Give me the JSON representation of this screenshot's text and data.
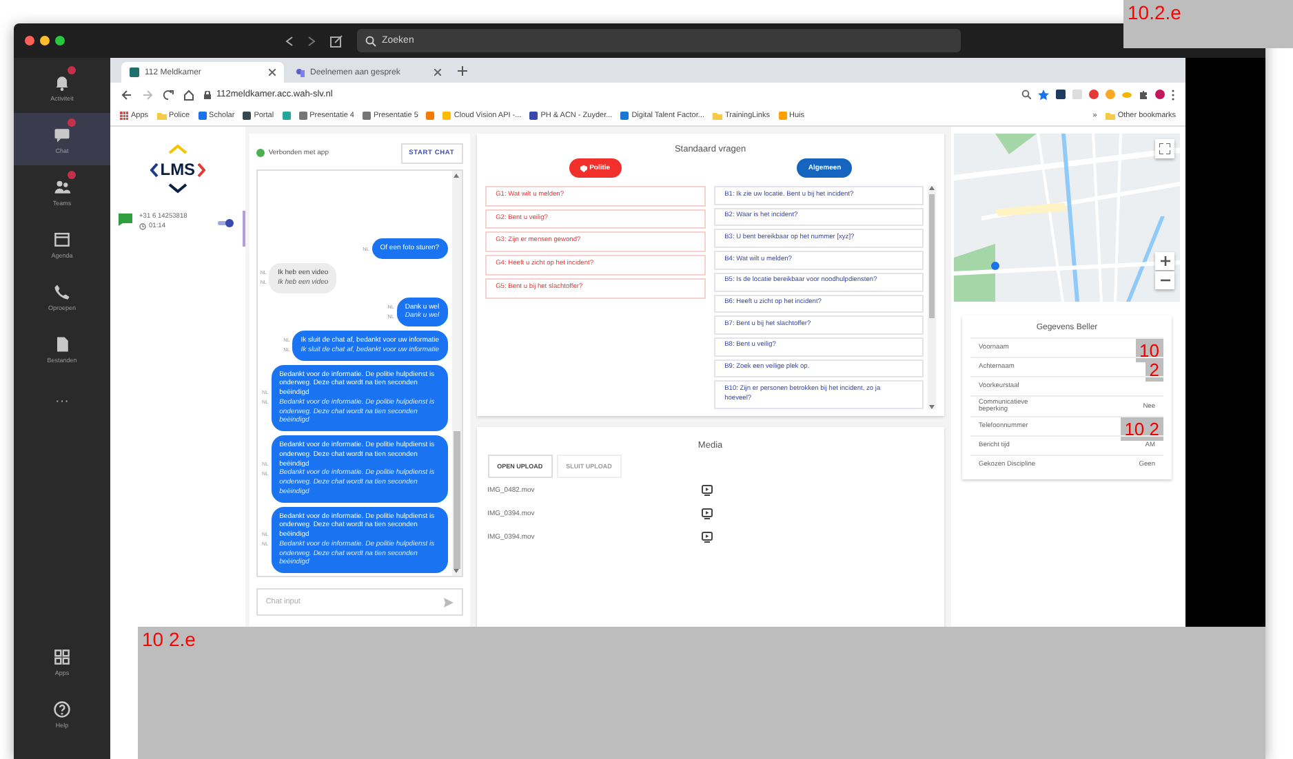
{
  "redactions": {
    "top": "10.2.e",
    "bottom": "10 2.e"
  },
  "teams": {
    "search_placeholder": "Zoeken",
    "rail": [
      {
        "kind": "bell",
        "label": "Activiteit",
        "badge": true,
        "selected": false
      },
      {
        "kind": "chat",
        "label": "Chat",
        "badge": true,
        "selected": true
      },
      {
        "kind": "people",
        "label": "Teams",
        "badge": true,
        "selected": false
      },
      {
        "kind": "calendar",
        "label": "Agenda",
        "badge": false,
        "selected": false
      },
      {
        "kind": "phone",
        "label": "Oproepen",
        "badge": false,
        "selected": false
      },
      {
        "kind": "file",
        "label": "Bestanden",
        "badge": false,
        "selected": false
      },
      {
        "kind": "more",
        "label": "···",
        "badge": false,
        "selected": false
      }
    ],
    "rail_bottom": [
      {
        "kind": "apps",
        "label": "Apps"
      },
      {
        "kind": "help",
        "label": "Help"
      }
    ]
  },
  "browser": {
    "tabs": [
      {
        "title": "112 Meldkamer",
        "kind": "site",
        "selected": true
      },
      {
        "title": "Deelnemen aan gesprek",
        "kind": "teams",
        "selected": false
      }
    ],
    "url": "112meldkamer.acc.wah-slv.nl",
    "bookmarks": [
      {
        "kind": "apps",
        "label": "Apps"
      },
      {
        "kind": "folder",
        "label": "Police"
      },
      {
        "kind": "site",
        "label": "Scholar",
        "color": "#1a73e8"
      },
      {
        "kind": "site",
        "label": "Portal",
        "color": "#37474f"
      },
      {
        "kind": "site",
        "color": "#26a69a"
      },
      {
        "kind": "site",
        "label": "Presentatie 4",
        "color": "#757575"
      },
      {
        "kind": "site",
        "label": "Presentatie 5",
        "color": "#757575"
      },
      {
        "kind": "site",
        "color": "#f57c00"
      },
      {
        "kind": "site",
        "label": "Cloud Vision API -...",
        "color": "#fbbc04"
      },
      {
        "kind": "site",
        "label": "PH & ACN - Zuyder...",
        "color": "#3949ab"
      },
      {
        "kind": "site",
        "label": "Digital Talent Factor...",
        "color": "#1976d2"
      },
      {
        "kind": "folder",
        "label": "TrainingLinks"
      },
      {
        "kind": "site",
        "label": "Huis",
        "color": "#ffa000"
      }
    ],
    "more_bookmarks": "»",
    "other_bookmarks": "Other bookmarks"
  },
  "lms": {
    "logo": "LMS",
    "calls": [
      {
        "phone": "+31 6 14253818",
        "time": "01:14",
        "selected": true
      }
    ]
  },
  "chat": {
    "status": "Verbonden met app",
    "connected": true,
    "start_button": "START CHAT",
    "input_placeholder": "Chat input",
    "messages": [
      {
        "kind": "sent",
        "text": "Of een foto sturen?",
        "tags": [
          "NL"
        ]
      },
      {
        "kind": "received",
        "text": "Ik heb een video",
        "translation": "Ik heb een video",
        "tags": [
          "NL",
          "NL"
        ]
      },
      {
        "kind": "sent",
        "text": "Dank u wel",
        "translation": "Dank u wel",
        "tags": [
          "NL",
          "NL"
        ]
      },
      {
        "kind": "sent",
        "text": "Ik sluit de chat af, bedankt voor uw informatie",
        "translation": "Ik sluit de chat af, bedankt voor uw informatie",
        "tags": [
          "NL",
          "NL"
        ]
      },
      {
        "kind": "sent",
        "text": "Bedankt voor de informatie. De politie hulpdienst is onderweg. Deze chat wordt na tien seconden beëindigd",
        "translation": "Bedankt voor de informatie. De politie hulpdienst is onderweg. Deze chat wordt na tien seconden beëindigd",
        "tags": [
          "NL",
          "NL"
        ]
      },
      {
        "kind": "sent",
        "text": "Bedankt voor de informatie. De politie hulpdienst is onderweg. Deze chat wordt na tien seconden beëindigd",
        "translation": "Bedankt voor de informatie. De politie hulpdienst is onderweg. Deze chat wordt na tien seconden beëindigd",
        "tags": [
          "NL",
          "NL"
        ]
      },
      {
        "kind": "sent",
        "text": "Bedankt voor de informatie. De politie hulpdienst is onderweg. Deze chat wordt na tien seconden beëindigd",
        "translation": "Bedankt voor de informatie. De politie hulpdienst is onderweg. Deze chat wordt na tien seconden beëindigd",
        "tags": [
          "NL",
          "NL"
        ]
      }
    ]
  },
  "questions": {
    "title": "Standaard vragen",
    "groups": [
      {
        "kind": "police",
        "button": "Politie",
        "items": [
          "G1: Wat wilt u melden?",
          "G2: Bent u veilig?",
          "G3: Zijn er mensen gewond?",
          "G4: Heeft u zicht op het incident?",
          "G5: Bent u bij het slachtoffer?"
        ]
      },
      {
        "kind": "general",
        "button": "Algemeen",
        "items": [
          "B1: Ik zie uw locatie. Bent u bij het incident?",
          "B2: Waar is het incident?",
          "B3: U bent bereikbaar op het nummer [xyz]?",
          "B4: Wat wilt u melden?",
          "B5: Is de locatie bereikbaar voor noodhulpdiensten?",
          "B6: Heeft u zicht op het incident?",
          "B7: Bent u bij het slachtoffer?",
          "B8: Bent u veilig?",
          "B9: Zoek een veilige plek op.",
          "B10: Zijn er personen betrokken bij het incident, zo ja hoeveel?"
        ]
      }
    ]
  },
  "media": {
    "title": "Media",
    "buttons": [
      {
        "label": "OPEN UPLOAD",
        "disabled": false
      },
      {
        "label": "SLUIT UPLOAD",
        "disabled": true
      }
    ],
    "files": [
      "IMG_0482.mov",
      "IMG_0394.mov",
      "IMG_0394.mov"
    ]
  },
  "caller": {
    "title": "Gegevens Beller",
    "rows": [
      {
        "label": "Voornaam",
        "redaction": "10"
      },
      {
        "label": "Achternaam",
        "redaction": "2"
      },
      {
        "label": "Voorkeurstaal"
      },
      {
        "label": "Communicatieve beperking",
        "value": "Nee"
      },
      {
        "label": "Telefoonnummer",
        "redaction": "10 2"
      },
      {
        "label": "Bericht tijd",
        "value": "AM"
      },
      {
        "label": "Gekozen Discipline",
        "value": "Geen"
      }
    ]
  }
}
